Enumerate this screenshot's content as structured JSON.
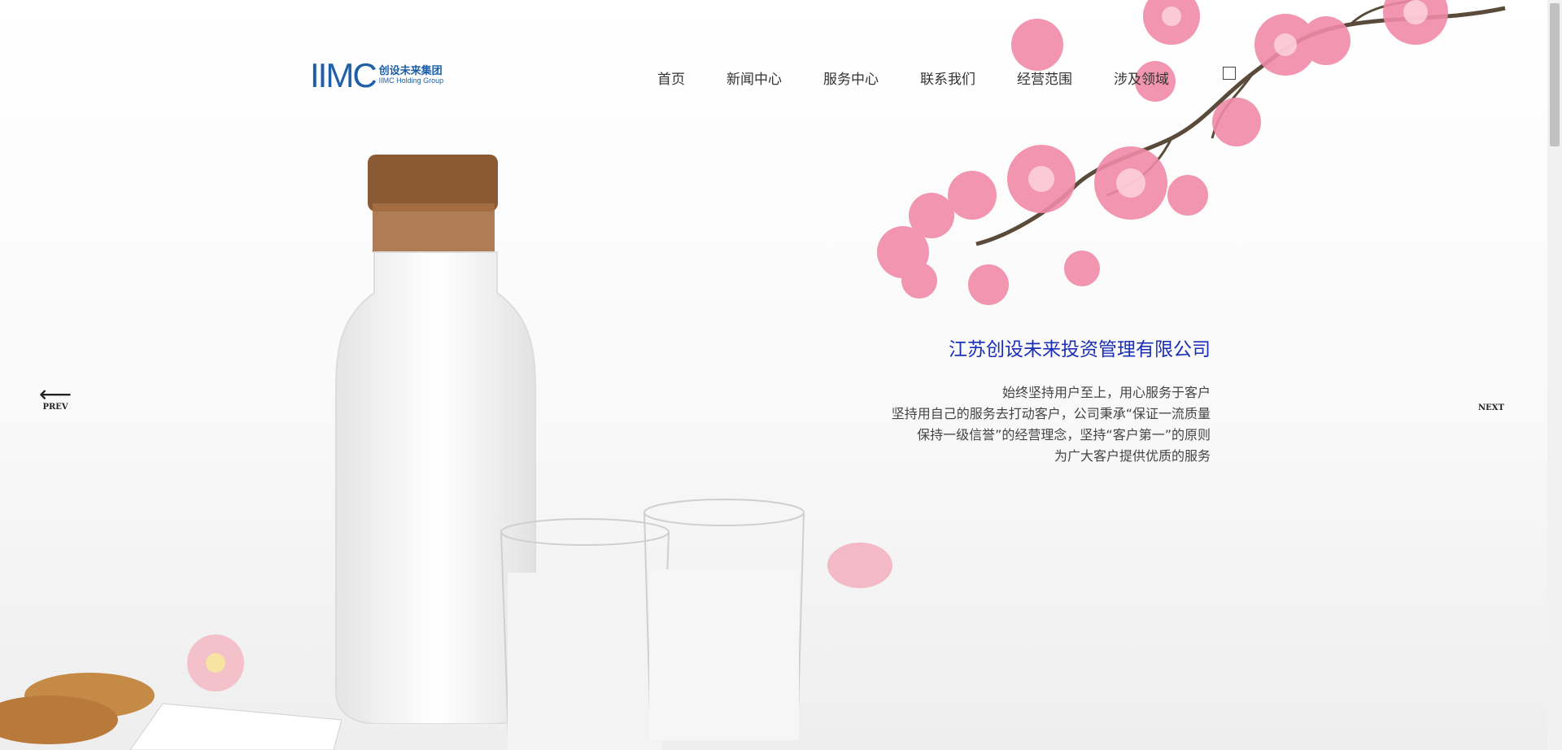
{
  "logo": {
    "mark": "IIMC",
    "cn": "创设未来集团",
    "en": "IIMC Holding Group",
    "color": "#1f5fa8"
  },
  "nav": {
    "items": [
      "首页",
      "新闻中心",
      "服务中心",
      "联系我们",
      "经营范围",
      "涉及领域"
    ],
    "search_icon": "search-icon"
  },
  "hero": {
    "title": "江苏创设未来投资管理有限公司",
    "title_color": "#1a2fb5",
    "lines": [
      "始终坚持用户至上，用心服务于客户",
      "坚持用自己的服务去打动客户，公司秉承“保证一流质量",
      "保持一级信誉”的经营理念，坚持“客户第一”的原则",
      "为广大客户提供优质的服务"
    ]
  },
  "slider": {
    "prev_arrow": "⟵",
    "prev_label": "PREV",
    "next_label": "NEXT"
  }
}
